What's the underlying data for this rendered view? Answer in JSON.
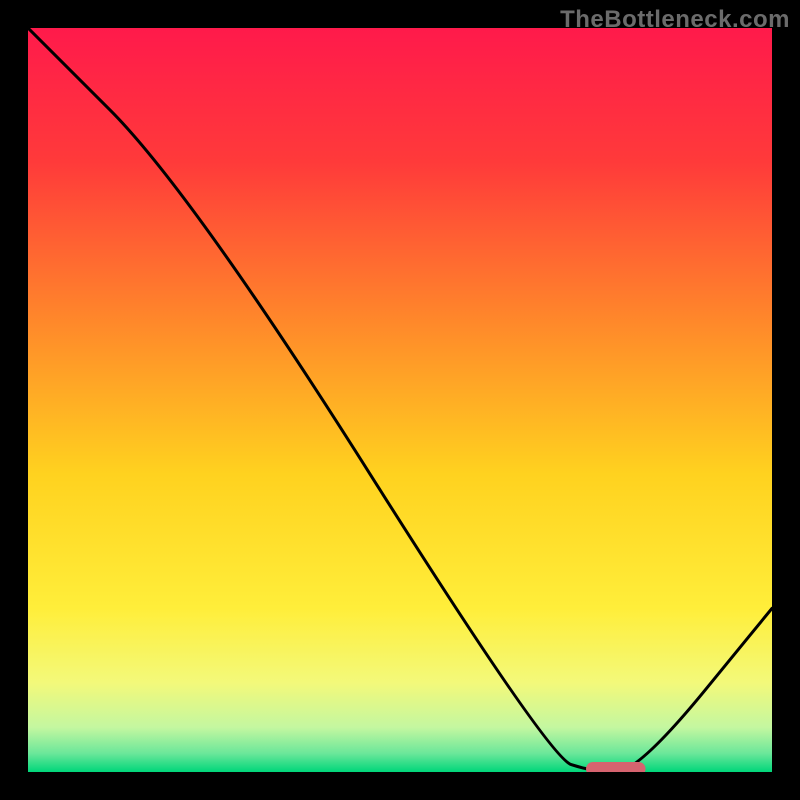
{
  "watermark": "TheBottleneck.com",
  "chart_data": {
    "type": "line",
    "title": "",
    "xlabel": "",
    "ylabel": "",
    "xlim": [
      0,
      100
    ],
    "ylim": [
      0,
      100
    ],
    "gradient_stops": [
      {
        "offset": 0,
        "color": "#ff1a4b"
      },
      {
        "offset": 0.18,
        "color": "#ff3a3a"
      },
      {
        "offset": 0.4,
        "color": "#ff8a2a"
      },
      {
        "offset": 0.6,
        "color": "#ffd21f"
      },
      {
        "offset": 0.78,
        "color": "#ffee3a"
      },
      {
        "offset": 0.88,
        "color": "#f3f97a"
      },
      {
        "offset": 0.94,
        "color": "#c4f7a0"
      },
      {
        "offset": 0.975,
        "color": "#6be79a"
      },
      {
        "offset": 1.0,
        "color": "#00d67a"
      }
    ],
    "series": [
      {
        "name": "bottleneck-curve",
        "x": [
          0,
          22,
          70,
          76,
          82,
          100
        ],
        "y": [
          100,
          78,
          2,
          0,
          0,
          22
        ]
      }
    ],
    "marker": {
      "name": "optimal-range",
      "x_start": 75,
      "x_end": 83,
      "y": 0,
      "color": "#d6636f"
    }
  }
}
